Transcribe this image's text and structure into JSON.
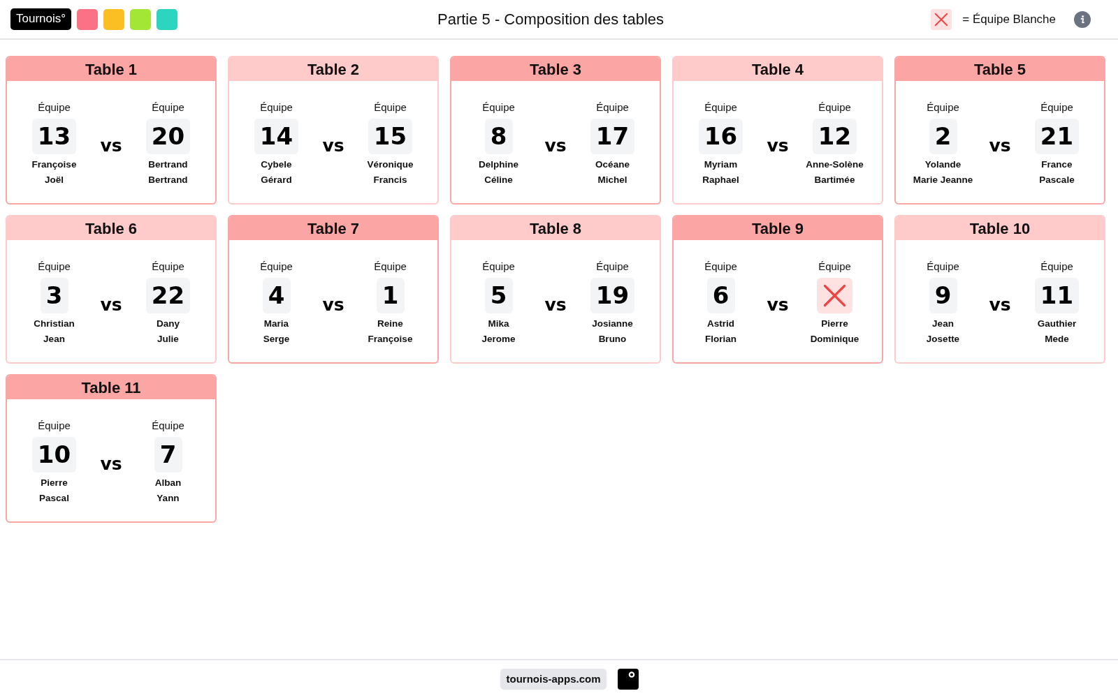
{
  "header": {
    "logo": "Tournois°",
    "swatches": [
      {
        "color": "#fb7185"
      },
      {
        "color": "#fbbf24"
      },
      {
        "color": "#a3e635"
      },
      {
        "color": "#2dd4bf"
      }
    ],
    "title": "Partie 5 - Composition des tables",
    "legend": {
      "text": "= Équipe Blanche"
    }
  },
  "tables": [
    {
      "title": "Table 1",
      "color": "#fca5a5",
      "separator": "vs",
      "teams": [
        {
          "kind": "number",
          "label": "Équipe",
          "number": "13",
          "players": [
            "Françoise",
            "Joël"
          ]
        },
        {
          "kind": "number",
          "label": "Équipe",
          "number": "20",
          "players": [
            "Bertrand",
            "Bertrand"
          ]
        }
      ]
    },
    {
      "title": "Table 2",
      "color": "#fecaca",
      "separator": "vs",
      "teams": [
        {
          "kind": "number",
          "label": "Équipe",
          "number": "14",
          "players": [
            "Cybele",
            "Gérard"
          ]
        },
        {
          "kind": "number",
          "label": "Équipe",
          "number": "15",
          "players": [
            "Véronique",
            "Francis"
          ]
        }
      ]
    },
    {
      "title": "Table 3",
      "color": "#fca5a5",
      "separator": "vs",
      "teams": [
        {
          "kind": "number",
          "label": "Équipe",
          "number": "8",
          "players": [
            "Delphine",
            "Céline"
          ]
        },
        {
          "kind": "number",
          "label": "Équipe",
          "number": "17",
          "players": [
            "Océane",
            "Michel"
          ]
        }
      ]
    },
    {
      "title": "Table 4",
      "color": "#fecaca",
      "separator": "vs",
      "teams": [
        {
          "kind": "number",
          "label": "Équipe",
          "number": "16",
          "players": [
            "Myriam",
            "Raphael"
          ]
        },
        {
          "kind": "number",
          "label": "Équipe",
          "number": "12",
          "players": [
            "Anne-Solène",
            "Bartimée"
          ]
        }
      ]
    },
    {
      "title": "Table 5",
      "color": "#fca5a5",
      "separator": "vs",
      "teams": [
        {
          "kind": "number",
          "label": "Équipe",
          "number": "2",
          "players": [
            "Yolande",
            "Marie Jeanne"
          ]
        },
        {
          "kind": "number",
          "label": "Équipe",
          "number": "21",
          "players": [
            "France",
            "Pascale"
          ]
        }
      ]
    },
    {
      "title": "Table 6",
      "color": "#fecaca",
      "separator": "vs",
      "teams": [
        {
          "kind": "number",
          "label": "Équipe",
          "number": "3",
          "players": [
            "Christian",
            "Jean"
          ]
        },
        {
          "kind": "number",
          "label": "Équipe",
          "number": "22",
          "players": [
            "Dany",
            "Julie"
          ]
        }
      ]
    },
    {
      "title": "Table 7",
      "color": "#fca5a5",
      "separator": "vs",
      "teams": [
        {
          "kind": "number",
          "label": "Équipe",
          "number": "4",
          "players": [
            "Maria",
            "Serge"
          ]
        },
        {
          "kind": "number",
          "label": "Équipe",
          "number": "1",
          "players": [
            "Reine",
            "Françoise"
          ]
        }
      ]
    },
    {
      "title": "Table 8",
      "color": "#fecaca",
      "separator": "vs",
      "teams": [
        {
          "kind": "number",
          "label": "Équipe",
          "number": "5",
          "players": [
            "Mika",
            "Jerome"
          ]
        },
        {
          "kind": "number",
          "label": "Équipe",
          "number": "19",
          "players": [
            "Josianne",
            "Bruno"
          ]
        }
      ]
    },
    {
      "title": "Table 9",
      "color": "#fca5a5",
      "separator": "vs",
      "teams": [
        {
          "kind": "number",
          "label": "Équipe",
          "number": "6",
          "players": [
            "Astrid",
            "Florian"
          ]
        },
        {
          "kind": "blank",
          "label": "Équipe",
          "players": [
            "Pierre",
            "Dominique"
          ]
        }
      ]
    },
    {
      "title": "Table 10",
      "color": "#fecaca",
      "separator": "vs",
      "teams": [
        {
          "kind": "number",
          "label": "Équipe",
          "number": "9",
          "players": [
            "Jean",
            "Josette"
          ]
        },
        {
          "kind": "number",
          "label": "Équipe",
          "number": "11",
          "players": [
            "Gauthier",
            "Mede"
          ]
        }
      ]
    },
    {
      "title": "Table 11",
      "color": "#fca5a5",
      "separator": "vs",
      "teams": [
        {
          "kind": "number",
          "label": "Équipe",
          "number": "10",
          "players": [
            "Pierre",
            "Pascal"
          ]
        },
        {
          "kind": "number",
          "label": "Équipe",
          "number": "7",
          "players": [
            "Alban",
            "Yann"
          ]
        }
      ]
    }
  ],
  "footer": {
    "site": "tournois-apps.com"
  }
}
